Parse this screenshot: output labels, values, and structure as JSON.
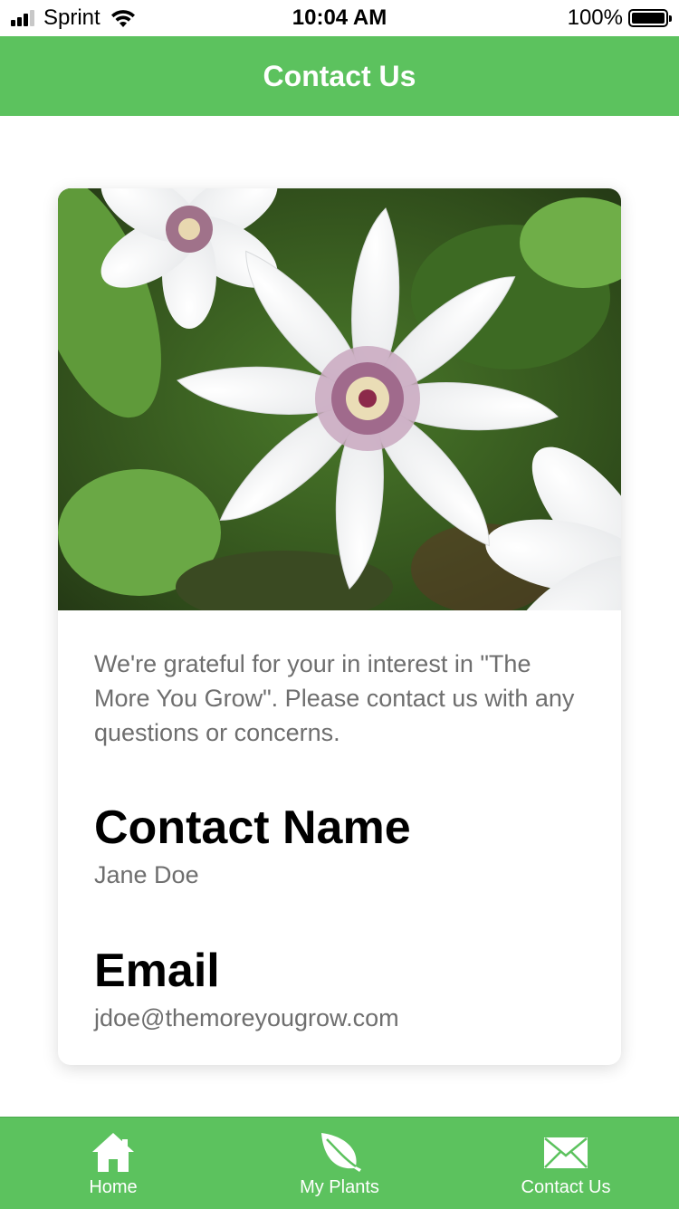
{
  "status_bar": {
    "carrier": "Sprint",
    "time": "10:04 AM",
    "battery": "100%"
  },
  "nav": {
    "title": "Contact Us"
  },
  "card": {
    "image_icon": "white-clematis-flower-photo",
    "intro": "We're grateful for your in interest in \"The More You Grow\". Please contact us with any questions or concerns.",
    "contact_name_heading": "Contact Name",
    "contact_name_value": "Jane Doe",
    "email_heading": "Email",
    "email_value": "jdoe@themoreyougrow.com"
  },
  "tabs": [
    {
      "label": "Home",
      "icon": "home-icon"
    },
    {
      "label": "My Plants",
      "icon": "leaf-icon"
    },
    {
      "label": "Contact Us",
      "icon": "envelope-icon"
    }
  ],
  "colors": {
    "accent": "#5cc25e",
    "text_muted": "#6e6e6e"
  }
}
